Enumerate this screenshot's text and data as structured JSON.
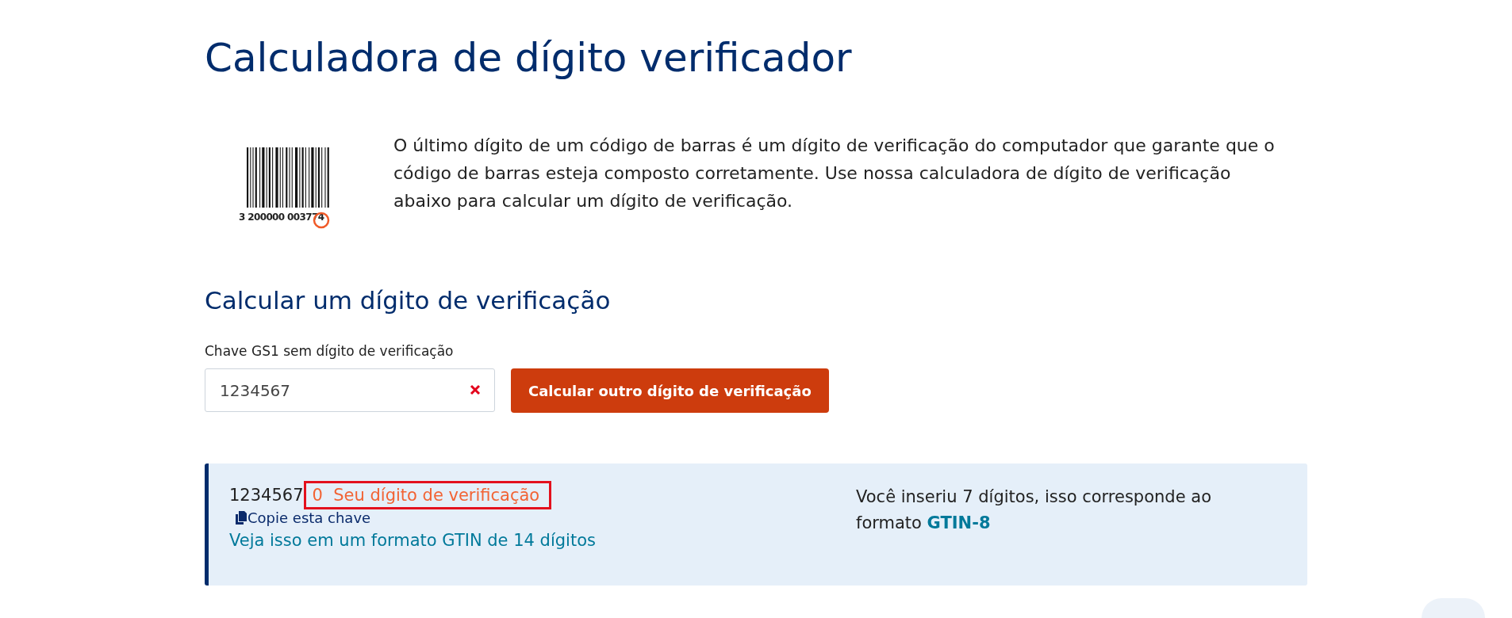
{
  "title": "Calculadora de dígito verificador",
  "intro": {
    "barcode_number": "3 200000 003774",
    "text": "O último dígito de um código de barras é um dígito de verificação do computador que garante que o código de barras esteja composto corretamente. Use nossa calculadora de dígito de verificação abaixo para calcular um dígito de verificação."
  },
  "section_title": "Calcular um dígito de verificação",
  "form": {
    "label": "Chave GS1 sem dígito de verificação",
    "value": "1234567",
    "button": "Calcular outro dígito de verificação"
  },
  "result": {
    "key": "1234567",
    "check_digit": "0",
    "check_label": "Seu dígito de verificação",
    "highlighted": true,
    "copy_link": "Copie esta chave",
    "gtin14_link": "Veja isso em um formato GTIN de 14 dígitos",
    "info": "Você inseriu 7 dígitos, isso corresponde ao formato **GTIN-8**"
  }
}
